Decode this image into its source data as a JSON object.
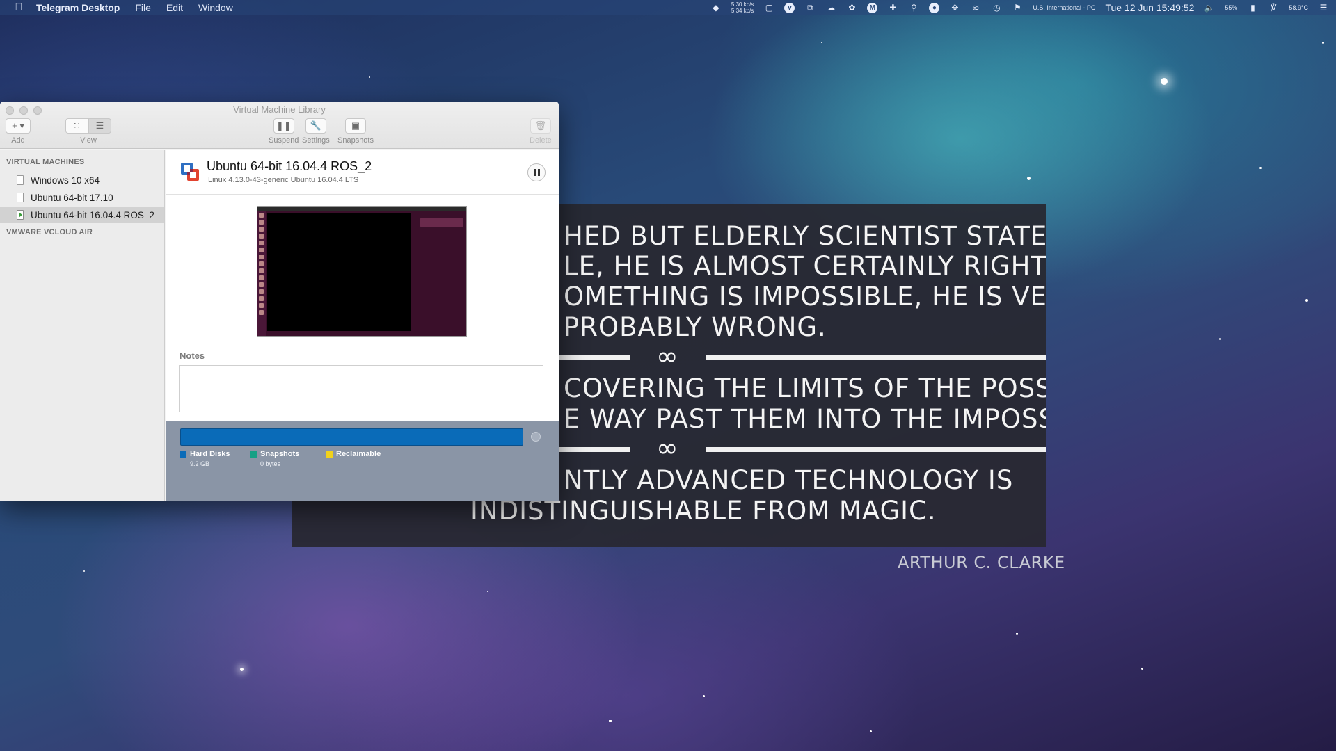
{
  "menubar": {
    "apple_icon": "apple-icon",
    "app_name": "Telegram Desktop",
    "menus": [
      "File",
      "Edit",
      "Window"
    ],
    "net_up": "5.30 kb/s",
    "net_down": "5.34 kb/s",
    "keyboard": "U.S. International - PC",
    "clock": "Tue 12 Jun  15:49:52",
    "battery": "55%",
    "temperature": "58.9°C"
  },
  "quote": {
    "lines": [
      "hed but elderly scientist states that",
      "le, he is almost certainly right. When",
      "omething is impossible, he is very",
      "probably wrong.",
      "covering the limits of the possible is",
      "e way past them into the impossible.",
      "ntly advanced technology is",
      "indistinguishable from magic."
    ],
    "separator": "∞",
    "attribution": "Arthur C. Clarke"
  },
  "window": {
    "title": "Virtual Machine Library",
    "toolbar": {
      "add": "Add",
      "view": "View",
      "suspend": "Suspend",
      "settings": "Settings",
      "snapshots": "Snapshots",
      "delete": "Delete"
    },
    "sidebar": {
      "section_vms": "VIRTUAL MACHINES",
      "items": [
        {
          "label": "Windows 10 x64"
        },
        {
          "label": "Ubuntu 64-bit 17.10"
        },
        {
          "label": "Ubuntu 64-bit 16.04.4 ROS_2"
        }
      ],
      "section_cloud": "VMWARE VCLOUD AIR"
    },
    "vm": {
      "name": "Ubuntu 64-bit 16.04.4 ROS_2",
      "os": "Linux 4.13.0-43-generic Ubuntu 16.04.4 LTS",
      "notes_label": "Notes",
      "notes_value": ""
    },
    "storage": {
      "hard_disks_label": "Hard Disks",
      "hard_disks_value": "9.2 GB",
      "snapshots_label": "Snapshots",
      "snapshots_value": "0 bytes",
      "reclaimable_label": "Reclaimable",
      "colors": {
        "hard_disks": "#0a6bb8",
        "snapshots": "#16a085",
        "reclaimable": "#f1d21c"
      }
    }
  }
}
